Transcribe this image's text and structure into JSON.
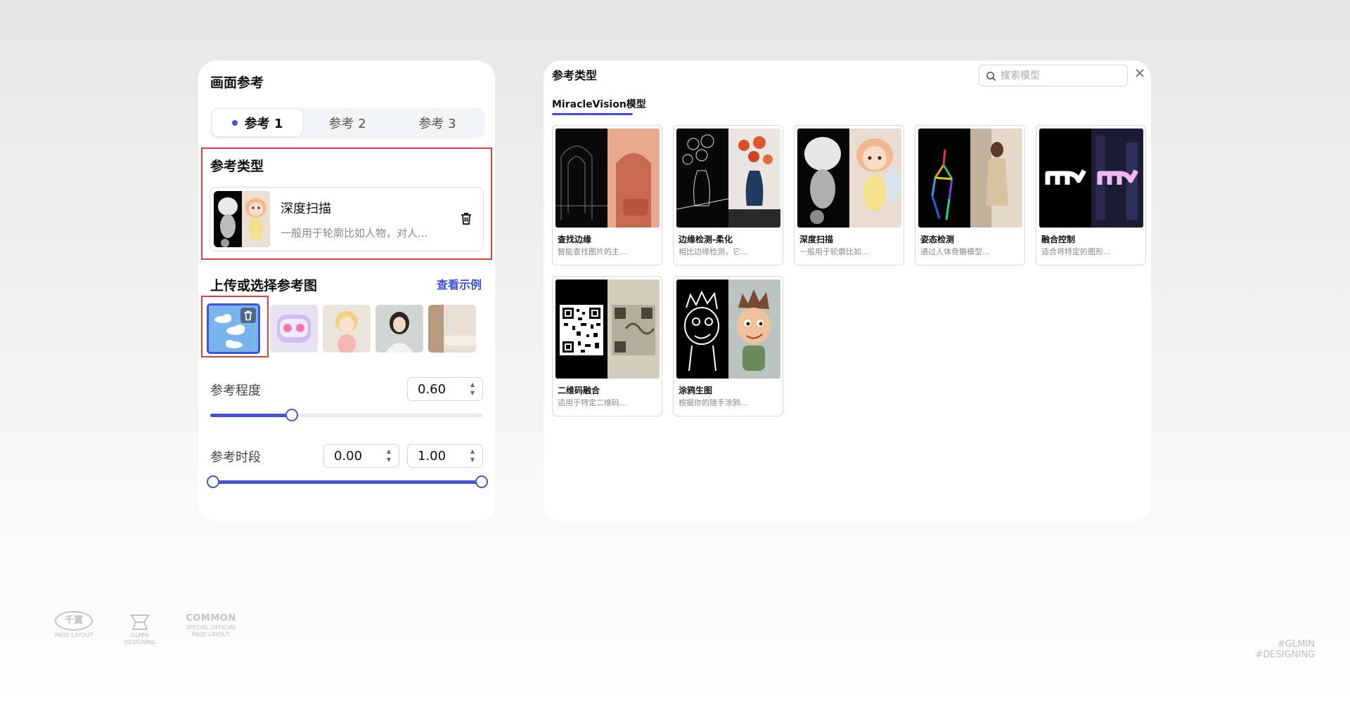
{
  "left_panel": {
    "title": "画面参考",
    "tabs": [
      {
        "label": "参考 1",
        "active": true
      },
      {
        "label": "参考 2",
        "active": false
      },
      {
        "label": "参考 3",
        "active": false
      }
    ],
    "ref_type_label": "参考类型",
    "selected_type": {
      "title": "深度扫描",
      "desc": "一般用于轮廓比如人物，对人..."
    },
    "upload_label": "上传或选择参考图",
    "view_example": "查看示例",
    "strength": {
      "label": "参考程度",
      "value": "0.60",
      "fraction": 0.3
    },
    "period": {
      "label": "参考时段",
      "start": "0.00",
      "end": "1.00"
    }
  },
  "right_panel": {
    "title": "参考类型",
    "search_placeholder": "搜索模型",
    "model_tab": "MiracleVision模型",
    "models": [
      {
        "name": "查找边缘",
        "desc": "智能查找图片的主..."
      },
      {
        "name": "边缘检测-柔化",
        "desc": "相比边缘检测，它..."
      },
      {
        "name": "深度扫描",
        "desc": "一般用于轮廓比如..."
      },
      {
        "name": "姿态检测",
        "desc": "通过人体骨骼模型..."
      },
      {
        "name": "融合控制",
        "desc": "适合将特定的图形..."
      },
      {
        "name": "二维码融合",
        "desc": "适用于特定二维码..."
      },
      {
        "name": "涂鸦生图",
        "desc": "根据你的随手涂鸦..."
      }
    ]
  },
  "footer": {
    "logo1": "千賞",
    "logo1_sub": "PAGE LAYOUT",
    "logo2_sub1": "GLMIN",
    "logo2_sub2": "DESIGNING",
    "logo3": "COMMON",
    "logo3_sub": "SPECIAL OFFICIAL PAGE LAYOUT",
    "tag1": "#GLMIN",
    "tag2": "#DESIGNING"
  },
  "colors": {
    "accent": "#4553d8",
    "highlight": "#e0403b"
  }
}
